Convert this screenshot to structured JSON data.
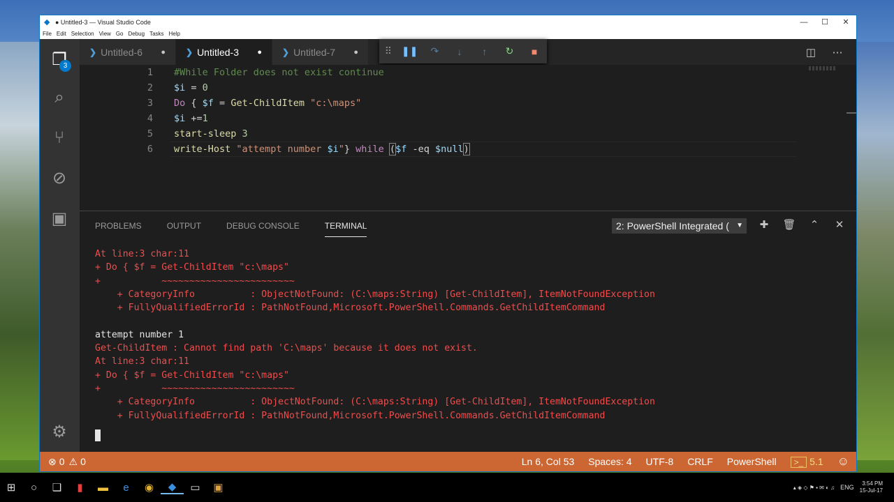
{
  "window": {
    "title": "● Untitled-3 — Visual Studio Code",
    "controls": [
      "—",
      "☐",
      "✕"
    ]
  },
  "menu": [
    "File",
    "Edit",
    "Selection",
    "View",
    "Go",
    "Debug",
    "Tasks",
    "Help"
  ],
  "activity": {
    "explorer_badge": "3"
  },
  "tabs": [
    {
      "label": "Untitled-6",
      "dirty": "●"
    },
    {
      "label": "Untitled-3",
      "dirty": "●"
    },
    {
      "label": "Untitled-7",
      "dirty": "●"
    }
  ],
  "editor": {
    "line_numbers": [
      "1",
      "2",
      "3",
      "4",
      "5",
      "6"
    ]
  },
  "panel": {
    "tabs": [
      "PROBLEMS",
      "OUTPUT",
      "DEBUG CONSOLE",
      "TERMINAL"
    ],
    "terminal_selector": "2: PowerShell Integrated ("
  },
  "terminal_lines": [
    "At line:3 char:11",
    "+ Do { $f = Get-ChildItem \"c:\\maps\"",
    "+           ~~~~~~~~~~~~~~~~~~~~~~~~",
    "    + CategoryInfo          : ObjectNotFound: (C:\\maps:String) [Get-ChildItem], ItemNotFoundException",
    "    + FullyQualifiedErrorId : PathNotFound,Microsoft.PowerShell.Commands.GetChildItemCommand",
    "",
    "attempt number 1",
    "Get-ChildItem : Cannot find path 'C:\\maps' because it does not exist.",
    "At line:3 char:11",
    "+ Do { $f = Get-ChildItem \"c:\\maps\"",
    "+           ~~~~~~~~~~~~~~~~~~~~~~~~",
    "    + CategoryInfo          : ObjectNotFound: (C:\\maps:String) [Get-ChildItem], ItemNotFoundException",
    "    + FullyQualifiedErrorId : PathNotFound,Microsoft.PowerShell.Commands.GetChildItemCommand"
  ],
  "status": {
    "errors": "0",
    "warnings": "0",
    "position": "Ln 6, Col 53",
    "spaces": "Spaces: 4",
    "encoding": "UTF-8",
    "eol": "CRLF",
    "language": "PowerShell",
    "ps_version": "5.1"
  },
  "taskbar": {
    "lang": "ENG",
    "time": "3:54 PM",
    "date": "15-Jul-17"
  },
  "colors": {
    "statusbar": "#cc6633",
    "accent": "#007acc",
    "error_text": "#f14c4c"
  }
}
